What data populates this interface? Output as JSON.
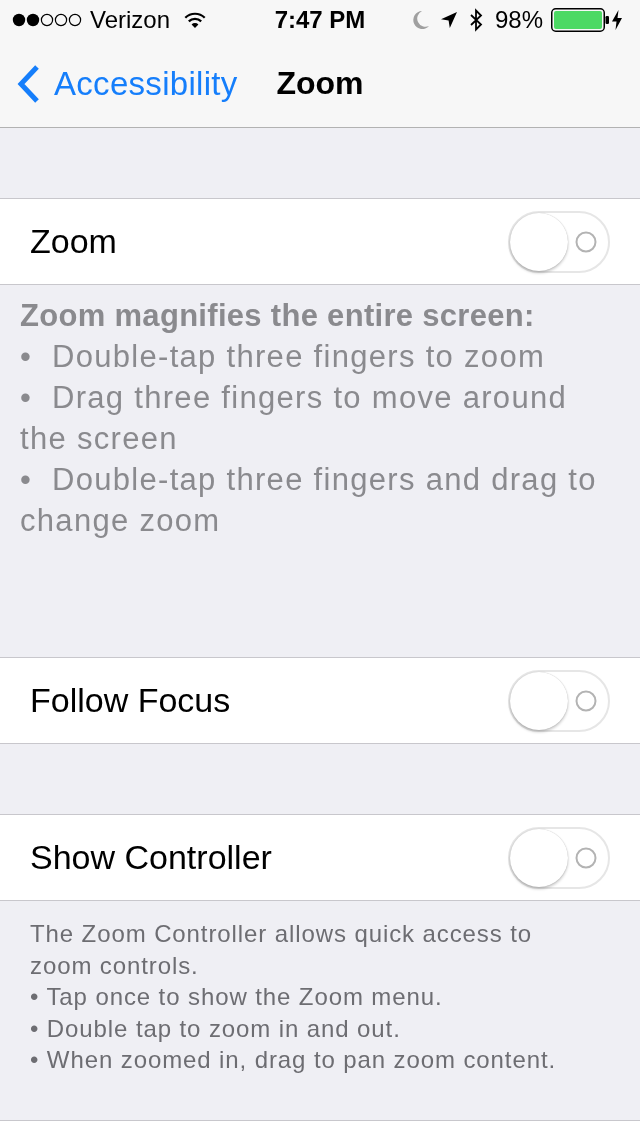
{
  "status_bar": {
    "carrier": "Verizon",
    "time": "7:47 PM",
    "battery": "98%"
  },
  "nav_bar": {
    "back": "Accessibility",
    "title": "Zoom"
  },
  "sections": [
    {
      "cells": [
        {
          "label": "Zoom",
          "on": false
        }
      ],
      "footer": {
        "kind": "large",
        "heading": "Zoom magnifies the entire screen:",
        "lines": [
          "•  Double-tap three fingers to zoom",
          "•  Drag three fingers to move around the screen",
          "•  Double-tap three fingers and drag to change zoom"
        ]
      }
    },
    {
      "cells": [
        {
          "label": "Follow Focus",
          "on": false
        }
      ]
    },
    {
      "cells": [
        {
          "label": "Show Controller",
          "on": false
        }
      ],
      "footer": {
        "kind": "small",
        "lines": [
          "The Zoom Controller allows quick access to zoom controls.",
          "• Tap once to show the Zoom menu.",
          "• Double tap to zoom in and out.",
          "• When zoomed in, drag to pan zoom content."
        ]
      }
    }
  ]
}
